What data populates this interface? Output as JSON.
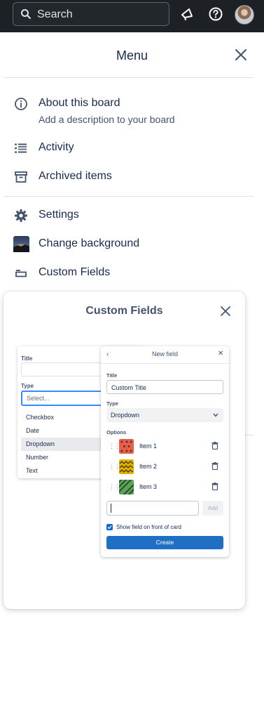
{
  "topbar": {
    "search_label": "Search",
    "search_icon": "search-icon",
    "notification_icon": "megaphone-icon",
    "help_icon": "help-icon",
    "avatar_icon": "avatar"
  },
  "menu": {
    "title": "Menu",
    "items": [
      {
        "label": "About this board",
        "sub": "Add a description to your board",
        "icon": "info-icon"
      },
      {
        "label": "Activity",
        "icon": "activity-list-icon"
      },
      {
        "label": "Archived items",
        "icon": "archive-icon"
      },
      {
        "label": "Settings",
        "icon": "gear-icon"
      },
      {
        "label": "Change background",
        "icon": "background-thumbnail"
      },
      {
        "label": "Custom Fields",
        "icon": "custom-fields-icon"
      }
    ]
  },
  "custom_fields_popover": {
    "title": "Custom Fields",
    "illustration": {
      "type_menu": {
        "title_label": "Title",
        "type_label": "Type",
        "select_placeholder": "Select...",
        "options": [
          "Checkbox",
          "Date",
          "Dropdown",
          "Number",
          "Text"
        ],
        "highlighted": "Dropdown"
      },
      "new_field": {
        "header": "New field",
        "title_label": "Title",
        "title_value": "Custom Title",
        "type_label": "Type",
        "type_value": "Dropdown",
        "options_label": "Options",
        "options": [
          {
            "label": "Item 1",
            "color": "#e5604b"
          },
          {
            "label": "Item 2",
            "color": "#e2b203"
          },
          {
            "label": "Item 3",
            "color": "#5aa45a"
          }
        ],
        "add_label": "Add",
        "show_on_front_label": "Show field on front of card",
        "show_on_front_checked": true,
        "create_label": "Create"
      }
    }
  },
  "colors": {
    "topbar_bg": "#1d2125",
    "primary_button": "#1f6fc5",
    "dropdown_highlight": "#e9eaee",
    "text": "#172b4d"
  }
}
